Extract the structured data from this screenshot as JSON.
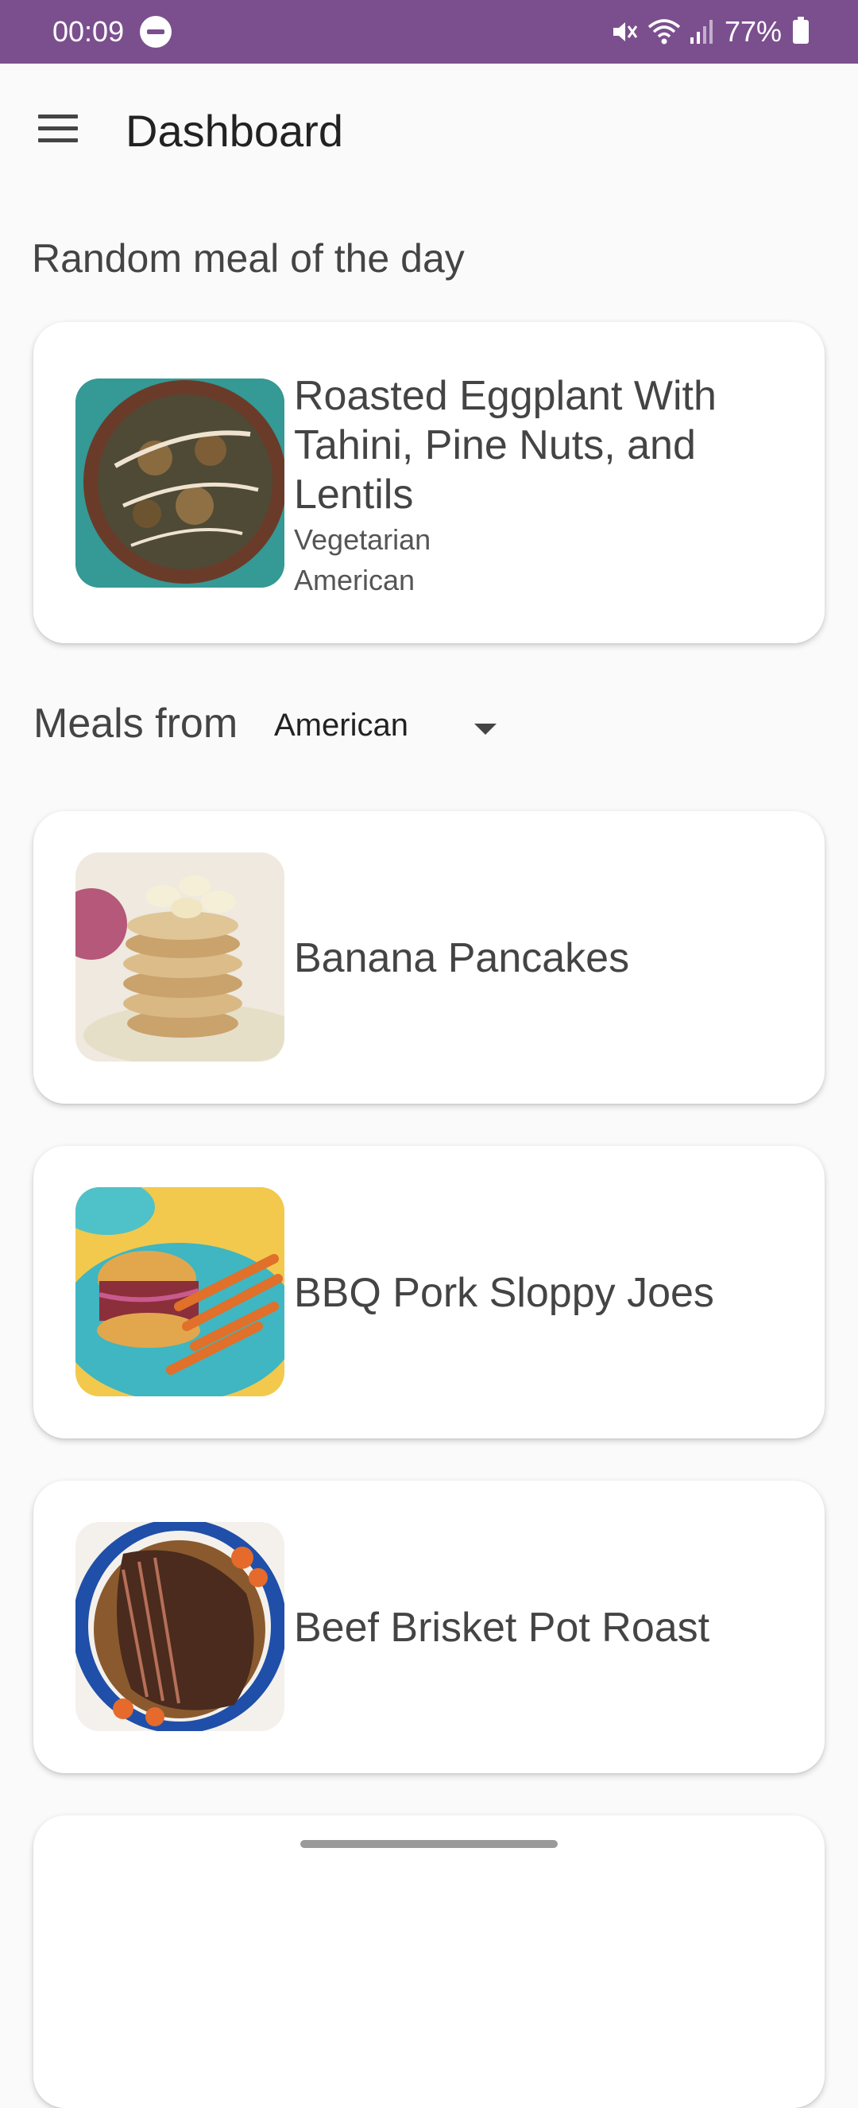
{
  "status_bar": {
    "time": "00:09",
    "battery": "77%",
    "background": "#7b4f8e"
  },
  "app_bar": {
    "title": "Dashboard",
    "menu_icon": "menu-icon"
  },
  "random_section": {
    "heading": "Random meal of the day",
    "meal": {
      "title": "Roasted Eggplant With Tahini, Pine Nuts, and Lentils",
      "category": "Vegetarian",
      "area": "American"
    }
  },
  "area_filter": {
    "label": "Meals from",
    "selected": "American"
  },
  "meals": [
    {
      "title": "Banana Pancakes"
    },
    {
      "title": "BBQ Pork Sloppy Joes"
    },
    {
      "title": "Beef Brisket Pot Roast"
    }
  ]
}
